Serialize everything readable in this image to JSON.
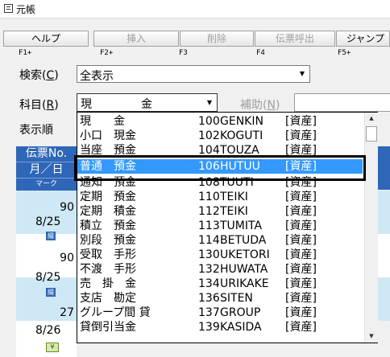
{
  "window": {
    "title": "元帳"
  },
  "toolbar": {
    "buttons": [
      {
        "label": "ヘルプ",
        "fkey": "F1+",
        "enabled": true
      },
      {
        "label": "挿入",
        "fkey": "F2+",
        "enabled": false
      },
      {
        "label": "削除",
        "fkey": "F3",
        "enabled": false
      },
      {
        "label": "伝票呼出",
        "fkey": "F4",
        "enabled": false
      },
      {
        "label": "ジャンプ",
        "fkey": "F5+",
        "enabled": true
      }
    ]
  },
  "search": {
    "label": "検索(C)",
    "label_main": "検索(",
    "label_key": "C",
    "label_end": ")",
    "value": "全表示"
  },
  "account": {
    "label_main": "科目(",
    "label_key": "R",
    "label_end": ")",
    "value_a": "現",
    "value_b": "金",
    "aux_main": "補助(",
    "aux_key": "N",
    "aux_end": ")"
  },
  "display_order": {
    "label": "表示順"
  },
  "grid": {
    "header1": "伝票No.",
    "header2": "月／日",
    "header3": "マーク",
    "rows": [
      {
        "no": "90",
        "date": "8/25",
        "mark": "綴"
      },
      {
        "no": "90",
        "date": "8/25",
        "mark": "綴"
      },
      {
        "no": "27",
        "date": "8/26",
        "mark": "¥"
      }
    ]
  },
  "dropdown": {
    "items": [
      {
        "name": "現　　金",
        "code": "100",
        "kana": "GENKIN",
        "cls": "[資産]"
      },
      {
        "name": "小口　現金",
        "code": "102",
        "kana": "KOGUTI",
        "cls": "[資産]"
      },
      {
        "name": "当座　預金",
        "code": "104",
        "kana": "TOUZA",
        "cls": "[資産]"
      },
      {
        "name": "普通　預金",
        "code": "106",
        "kana": "HUTUU",
        "cls": "[資産]",
        "selected": true
      },
      {
        "name": "通知　預金",
        "code": "108",
        "kana": "TUUTI",
        "cls": "[資産]"
      },
      {
        "name": "定期　預金",
        "code": "110",
        "kana": "TEIKI",
        "cls": "[資産]"
      },
      {
        "name": "定期　積金",
        "code": "112",
        "kana": "TEIKI",
        "cls": "[資産]"
      },
      {
        "name": "積立　預金",
        "code": "113",
        "kana": "TUMITA",
        "cls": "[資産]"
      },
      {
        "name": "別段　預金",
        "code": "114",
        "kana": "BETUDA",
        "cls": "[資産]"
      },
      {
        "name": "受取　手形",
        "code": "130",
        "kana": "UKETORI",
        "cls": "[資産]"
      },
      {
        "name": "不渡　手形",
        "code": "132",
        "kana": "HUWATA",
        "cls": "[資産]"
      },
      {
        "name": "売　掛　金",
        "code": "134",
        "kana": "URIKAKE",
        "cls": "[資産]"
      },
      {
        "name": "支店　勘定",
        "code": "136",
        "kana": "SITEN",
        "cls": "[資産]"
      },
      {
        "name": "グループ間 貸",
        "code": "137",
        "kana": "GROUP",
        "cls": "[資産]"
      },
      {
        "name": "貸倒引当金",
        "code": "139",
        "kana": "KASIDA",
        "cls": "[資産]"
      }
    ]
  },
  "colors": {
    "selection": "#3399ff",
    "header": "#2f67b8",
    "row_light": "#cfe8f5"
  }
}
